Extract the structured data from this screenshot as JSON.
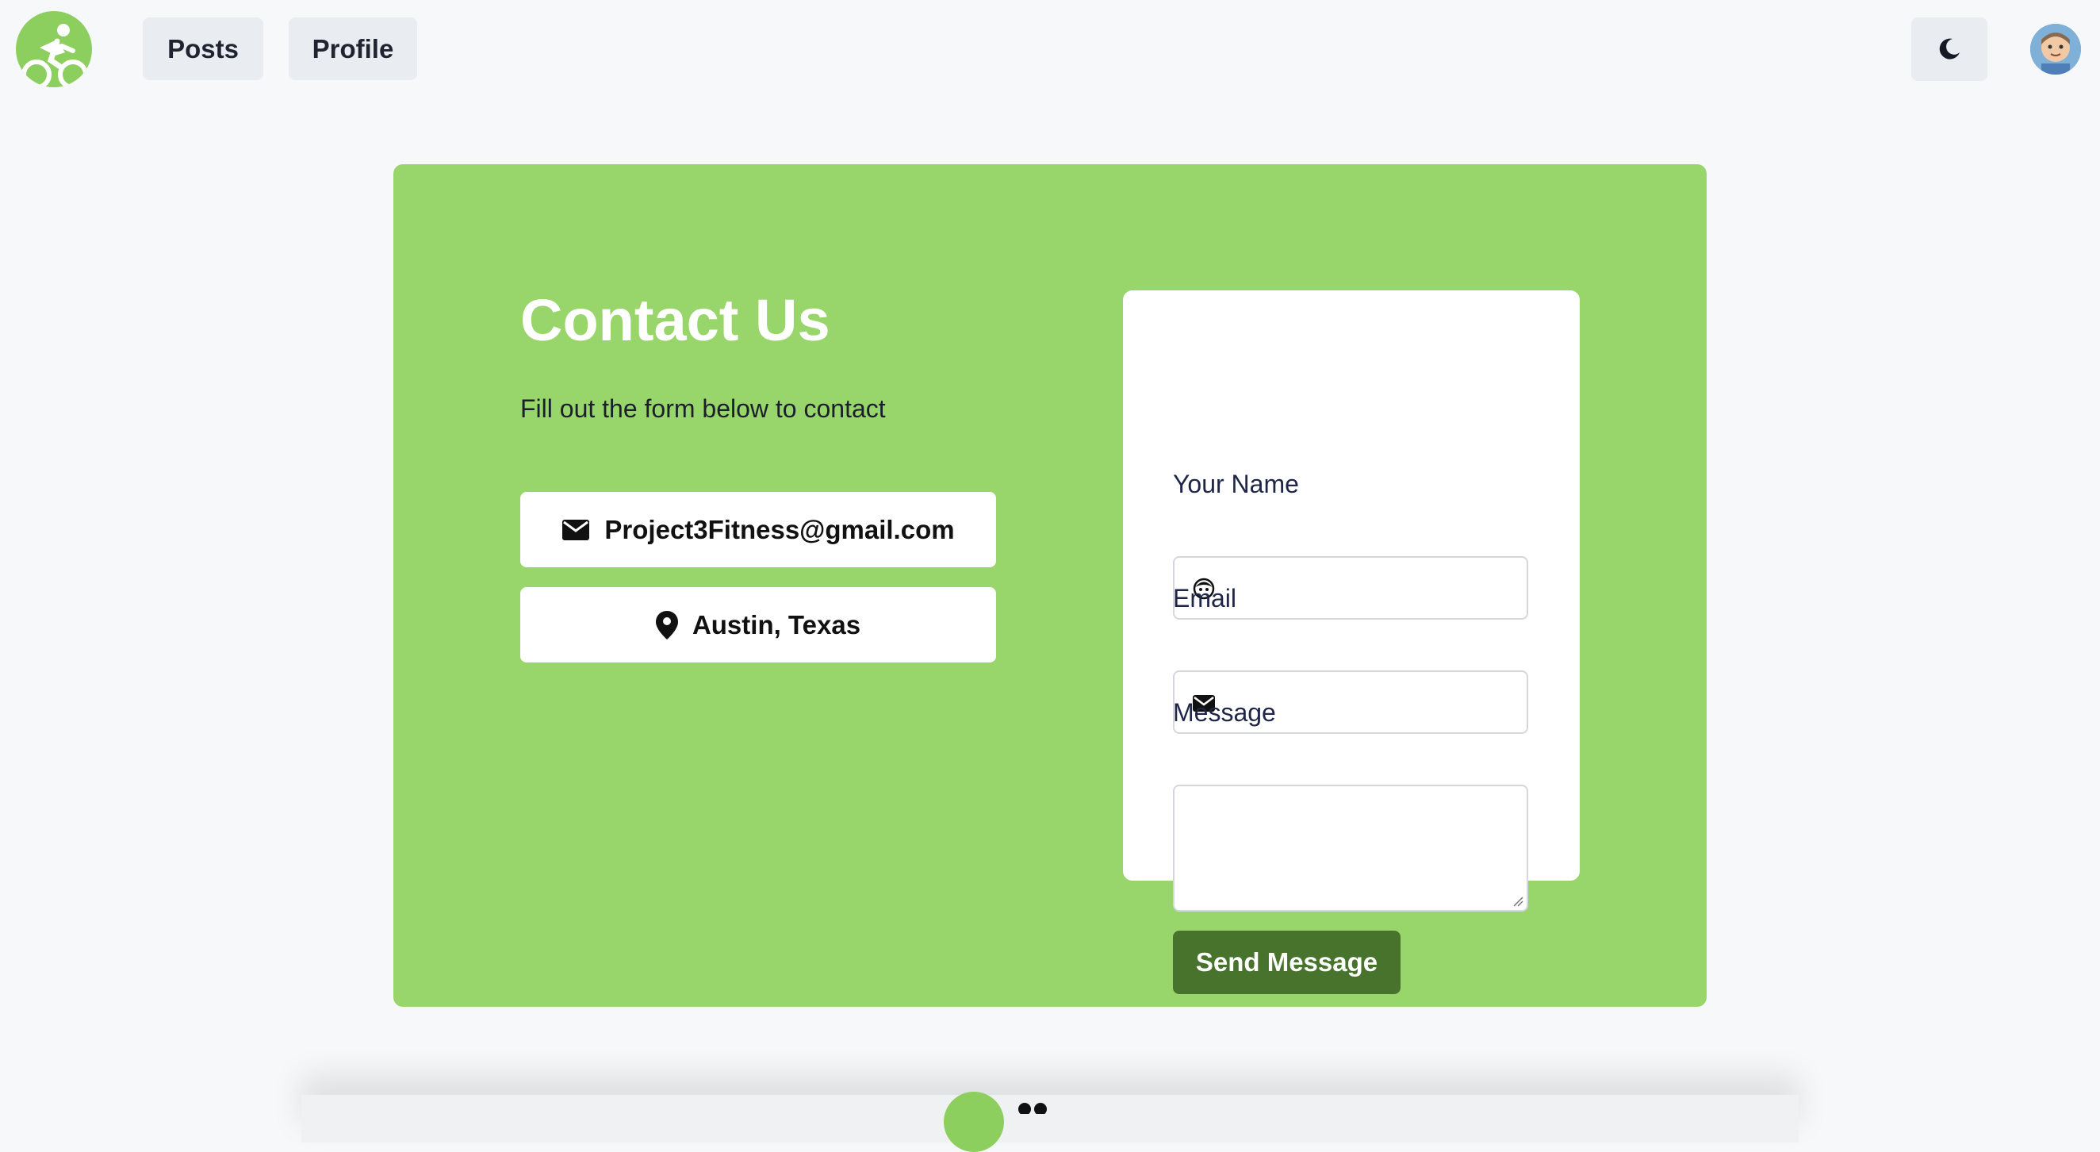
{
  "nav": {
    "logo_icon": "cyclist-logo-icon",
    "items": [
      {
        "label": "Posts"
      },
      {
        "label": "Profile"
      }
    ],
    "theme_icon": "moon-icon",
    "avatar_icon": "user-avatar"
  },
  "contact": {
    "title": "Contact Us",
    "subtitle": "Fill out the form below to contact",
    "email": "Project3Fitness@gmail.com",
    "email_icon": "mail-icon",
    "location": "Austin, Texas",
    "location_icon": "map-pin-icon"
  },
  "form": {
    "name_label": "Your Name",
    "name_value": "",
    "name_icon": "face-icon",
    "email_label": "Email",
    "email_value": "",
    "email_icon": "mail-icon",
    "message_label": "Message",
    "message_value": "",
    "submit_label": "Send Message"
  },
  "colors": {
    "panel": "#98d66c",
    "accent_button": "#47732c",
    "logo": "#8ccf5e",
    "background": "#f7f8fa"
  }
}
